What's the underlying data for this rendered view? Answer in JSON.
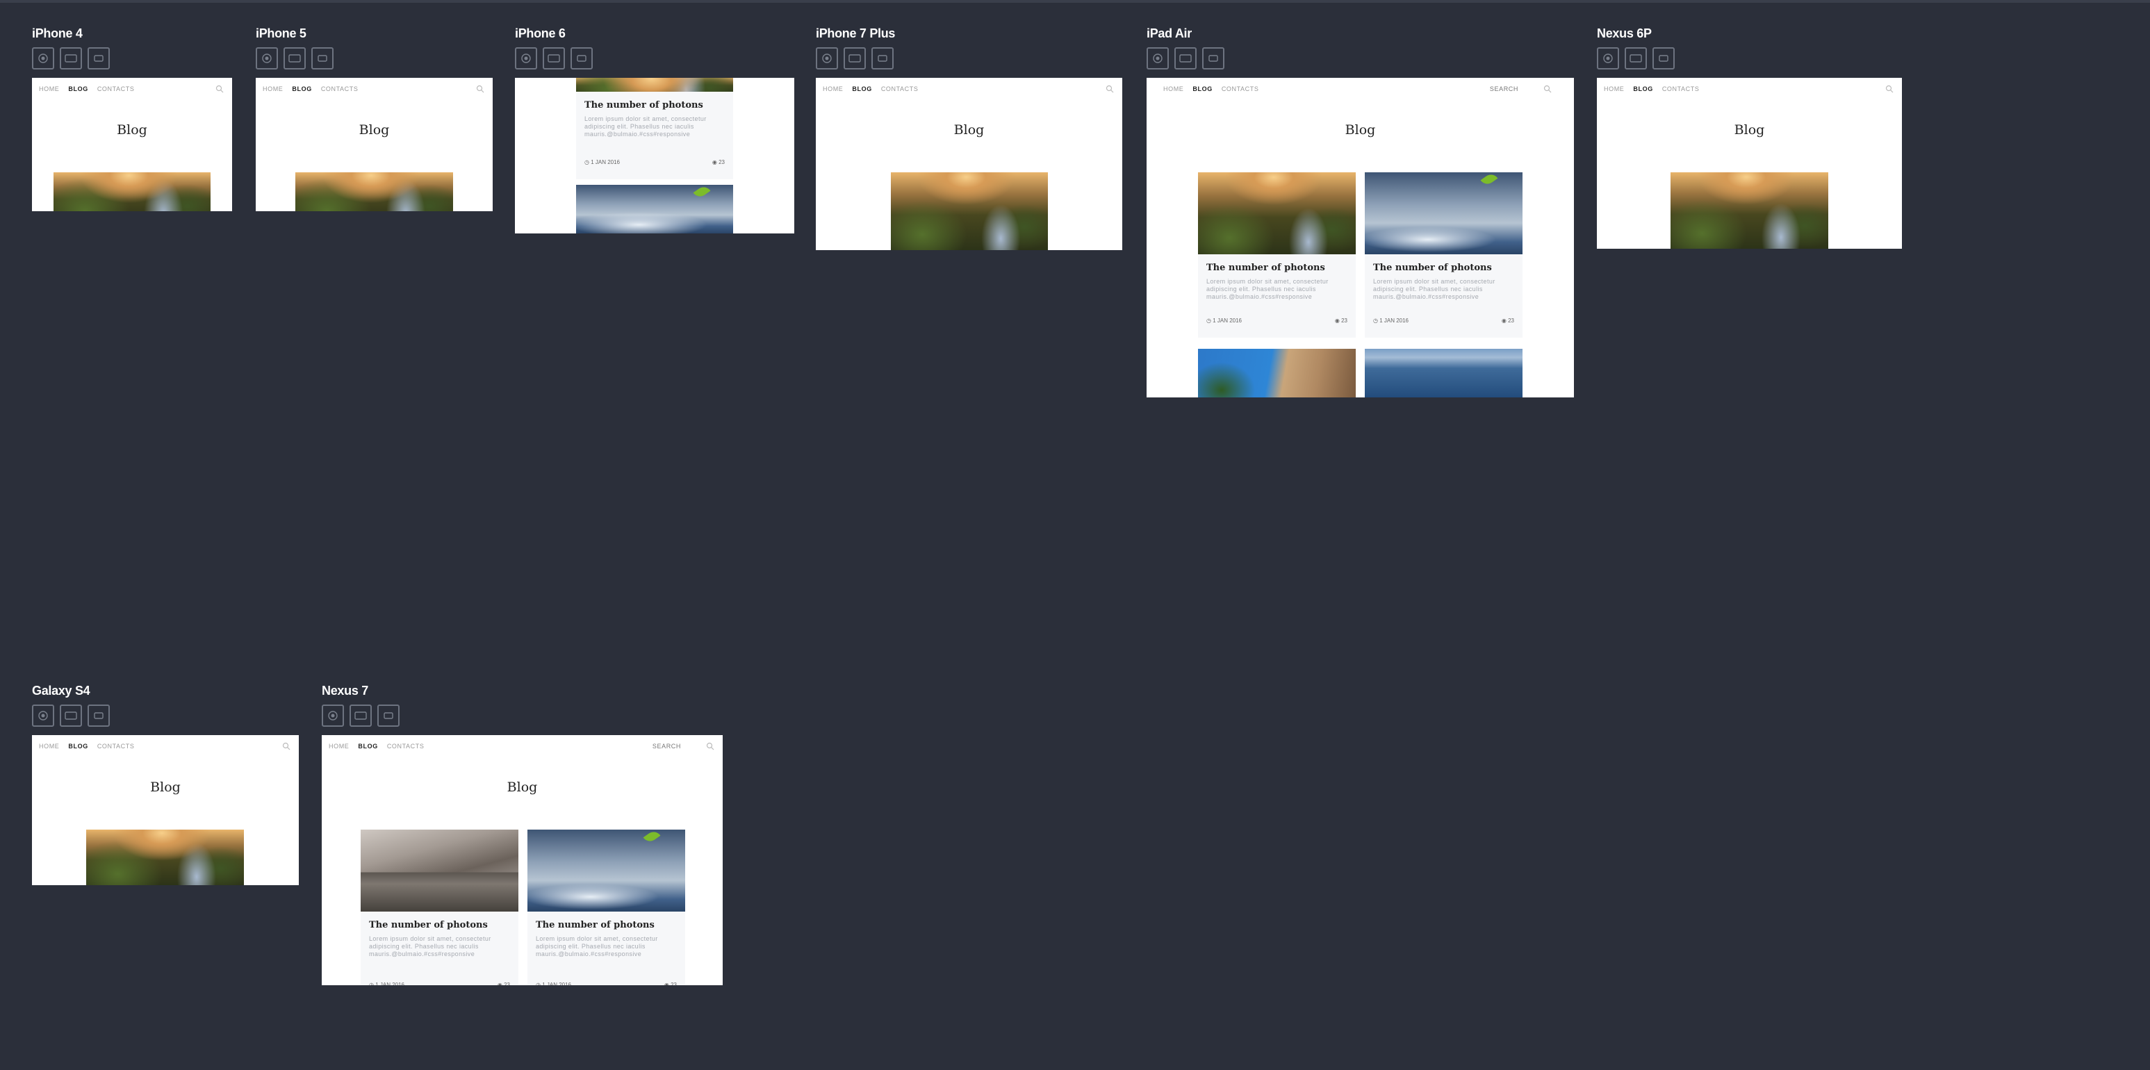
{
  "devices": [
    {
      "name": "iPhone 4"
    },
    {
      "name": "iPhone 5"
    },
    {
      "name": "iPhone 6"
    },
    {
      "name": "iPhone 7 Plus"
    },
    {
      "name": "iPad Air"
    },
    {
      "name": "Nexus 6P"
    },
    {
      "name": "Galaxy S4"
    },
    {
      "name": "Nexus 7"
    }
  ],
  "controls": {
    "icons": [
      "target-icon",
      "landscape-icon",
      "portrait-icon"
    ]
  },
  "site": {
    "nav": {
      "home": "HOME",
      "blog": "BLOG",
      "contacts": "CONTACTS",
      "search": "SEARCH"
    },
    "blog_title": "Blog",
    "post": {
      "title": "The number of photons",
      "excerpt": "Lorem ipsum dolor sit amet, consectetur adipiscing elit. Phasellus nec iaculis mauris.@bulmaio.#css#responsive",
      "date": "1 JAN 2016",
      "views": "23"
    }
  },
  "colors": {
    "background": "#2b2f3a",
    "screen": "#ffffff",
    "card": "#f6f7f9",
    "accent_kite": "#7cbc2a"
  }
}
